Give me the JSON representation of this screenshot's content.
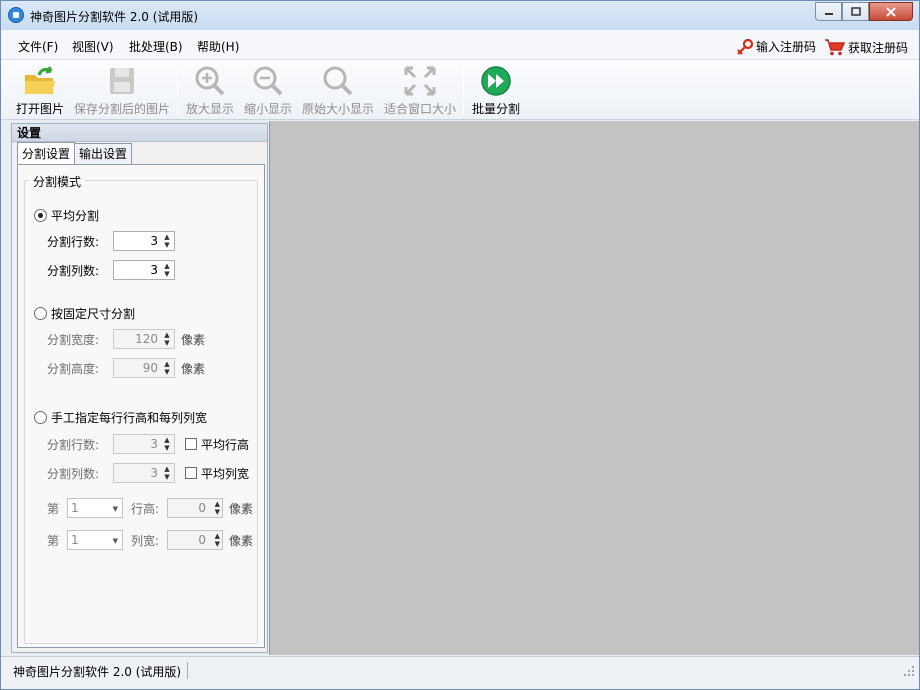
{
  "window": {
    "title": "神奇图片分割软件 2.0 (试用版)"
  },
  "menu": {
    "items": [
      "文件(F)",
      "视图(V)",
      "批处理(B)",
      "帮助(H)"
    ],
    "register_label": "输入注册码",
    "get_code_label": "获取注册码"
  },
  "toolbar": {
    "open_label": "打开图片",
    "save_label": "保存分割后的图片",
    "zoom_in_label": "放大显示",
    "zoom_out_label": "缩小显示",
    "original_label": "原始大小显示",
    "fit_label": "适合窗口大小",
    "batch_label": "批量分割"
  },
  "panel": {
    "title": "设置",
    "tabs": [
      "分割设置",
      "输出设置"
    ],
    "group_title": "分割模式",
    "mode_even": {
      "label": "平均分割",
      "rows_label": "分割行数:",
      "rows_value": "3",
      "cols_label": "分割列数:",
      "cols_value": "3"
    },
    "mode_fixed": {
      "label": "按固定尺寸分割",
      "width_label": "分割宽度:",
      "width_value": "120",
      "height_label": "分割高度:",
      "height_value": "90",
      "unit": "像素"
    },
    "mode_manual": {
      "label": "手工指定每行行高和每列列宽",
      "rows_label": "分割行数:",
      "rows_value": "3",
      "even_rows_label": "平均行高",
      "cols_label": "分割列数:",
      "cols_value": "3",
      "even_cols_label": "平均列宽",
      "nth_label": "第",
      "row_select": "1",
      "row_height_label": "行高:",
      "row_height_value": "0",
      "col_select": "1",
      "col_width_label": "列宽:",
      "col_width_value": "0",
      "unit": "像素"
    }
  },
  "status": {
    "text": "神奇图片分割软件 2.0 (试用版)"
  },
  "colors": {
    "accent": "#2f8ae0",
    "canvas": "#c3c3c3",
    "close": "#c74a35",
    "batch": "#1faa5a"
  }
}
